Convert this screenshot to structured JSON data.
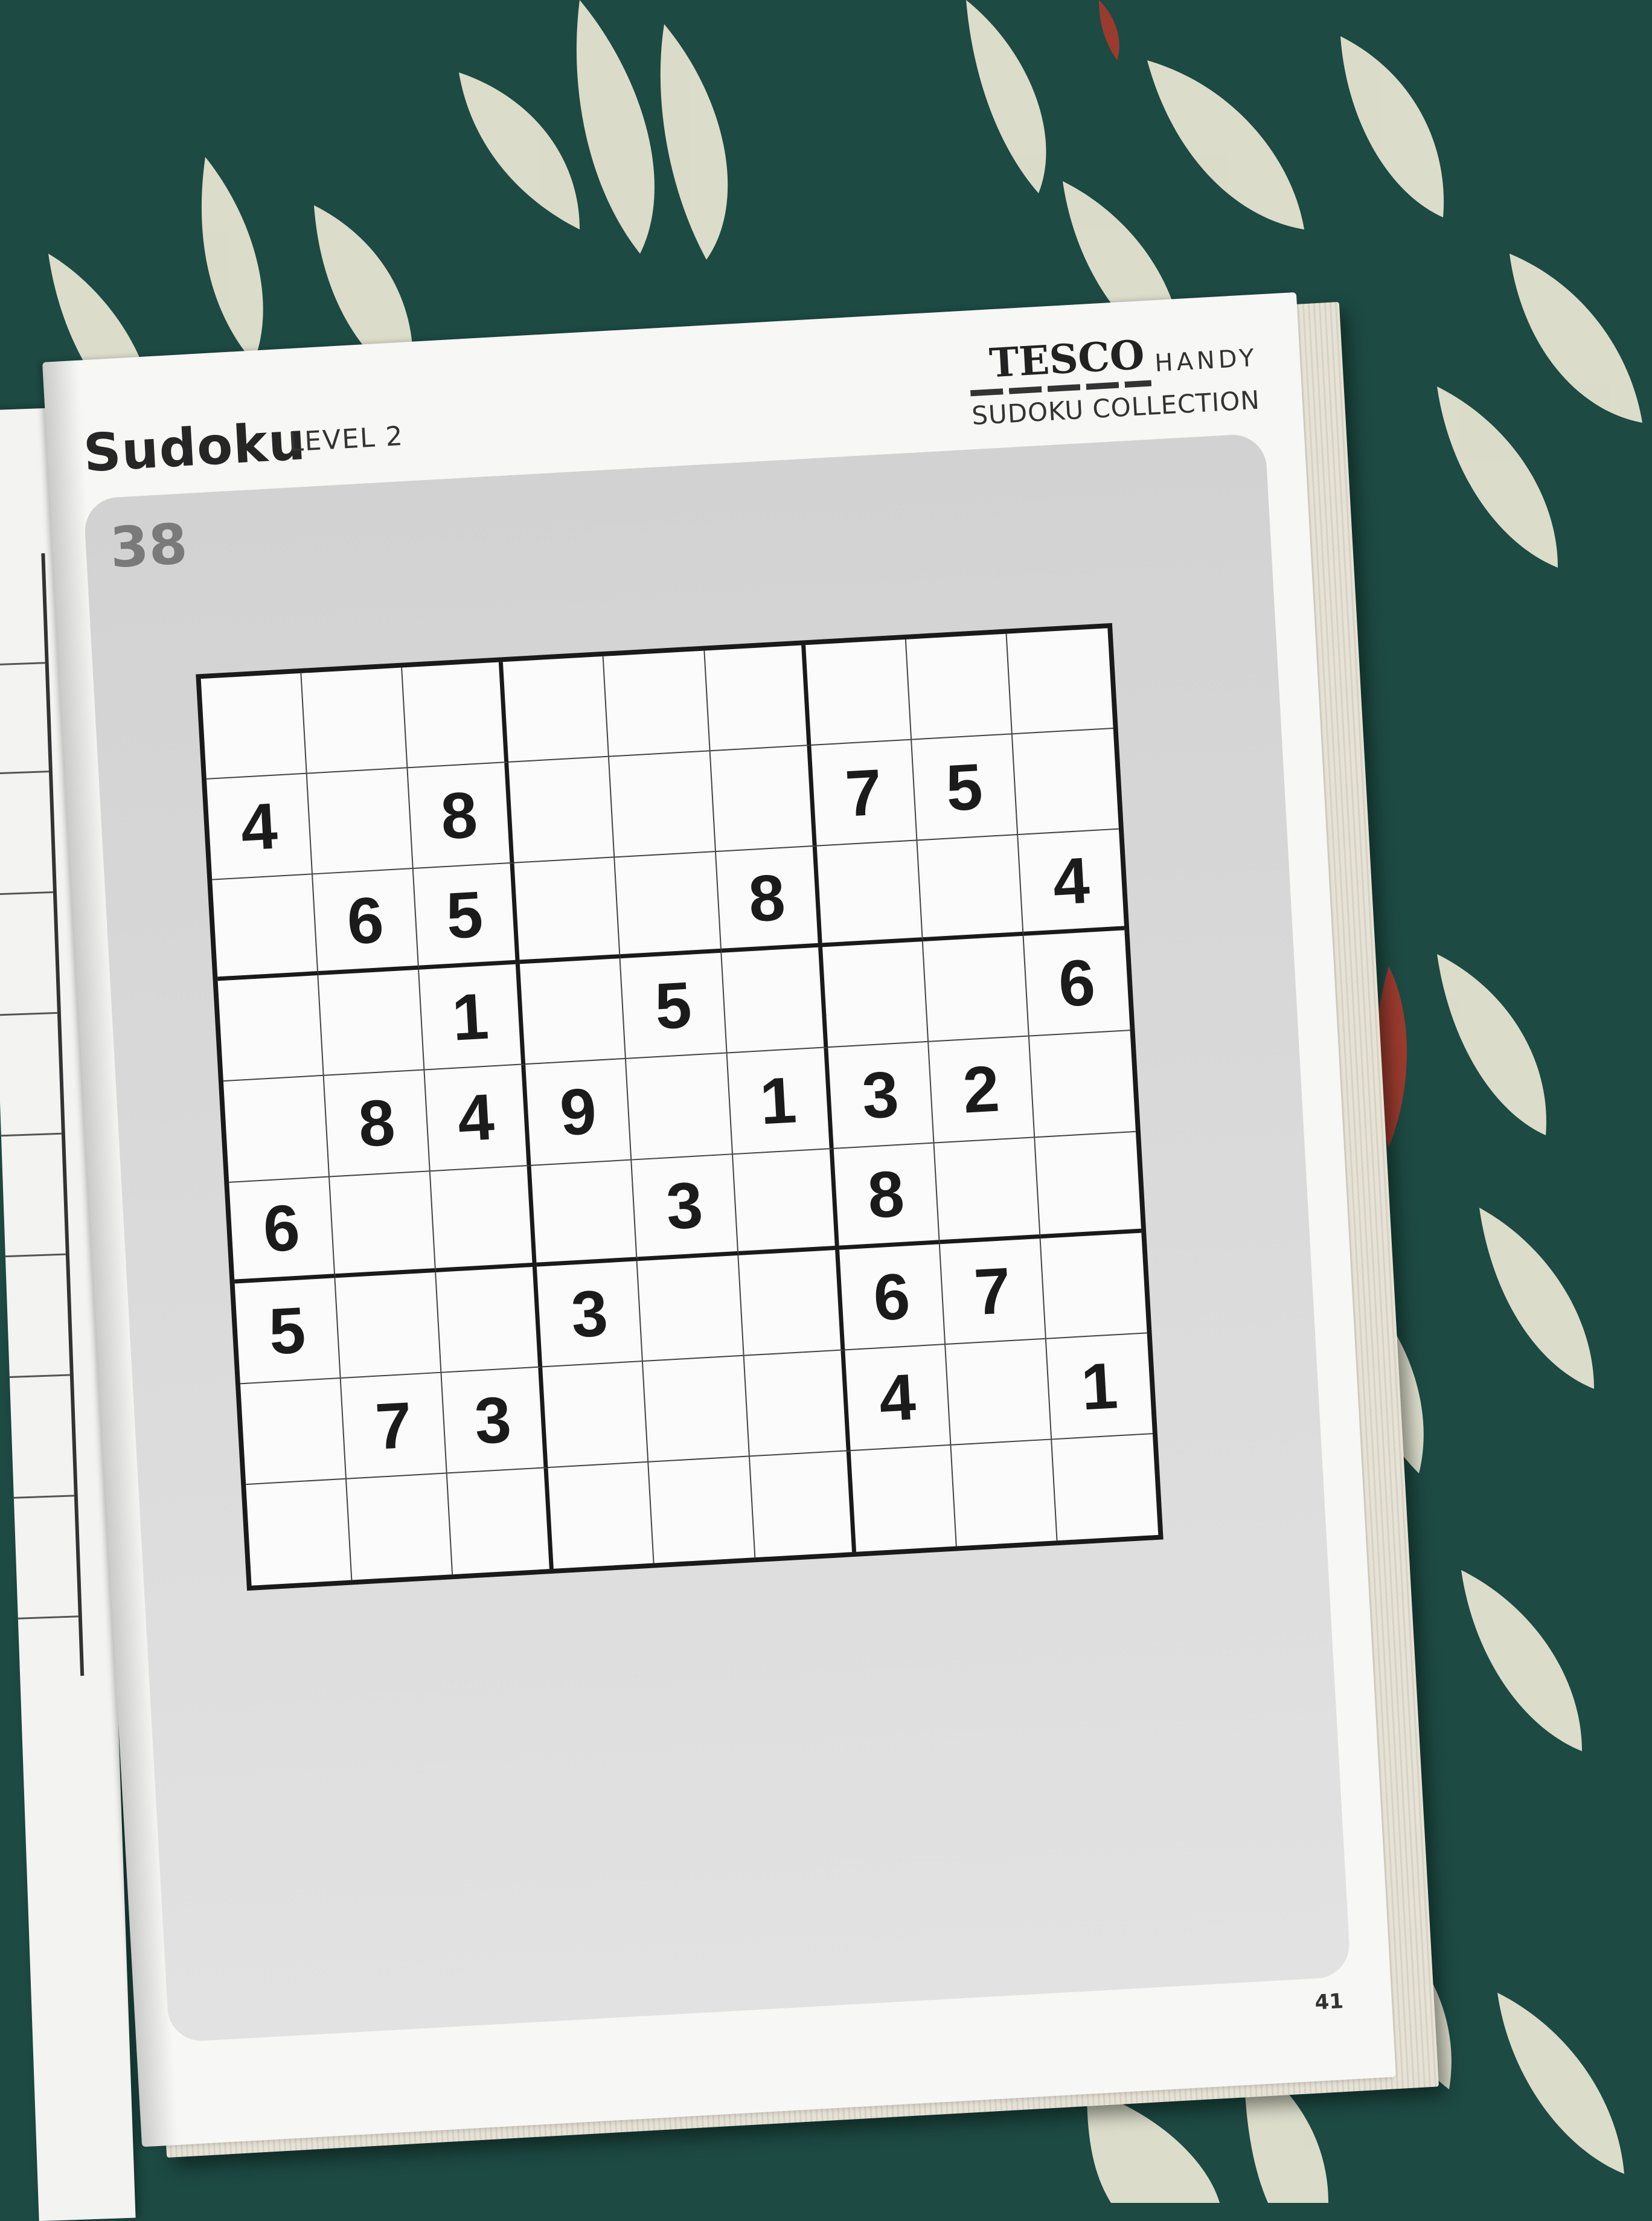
{
  "book": {
    "title": "Sudoku",
    "level": "LEVEL 2",
    "brand": "TESCO",
    "brand_suffix": "HANDY",
    "collection": "SUDOKU COLLECTION",
    "puzzle_number": "38",
    "page_number": "41"
  },
  "sudoku": {
    "grid": [
      [
        "",
        "",
        "",
        "",
        "",
        "",
        "",
        "",
        ""
      ],
      [
        "4",
        "",
        "8",
        "",
        "",
        "",
        "7",
        "5",
        ""
      ],
      [
        "",
        "6",
        "5",
        "",
        "",
        "8",
        "",
        "",
        "4"
      ],
      [
        "",
        "",
        "1",
        "",
        "5",
        "",
        "",
        "",
        "6"
      ],
      [
        "",
        "8",
        "4",
        "9",
        "",
        "1",
        "3",
        "2",
        ""
      ],
      [
        "6",
        "",
        "",
        "",
        "3",
        "",
        "8",
        "",
        ""
      ],
      [
        "5",
        "",
        "",
        "3",
        "",
        "",
        "6",
        "7",
        ""
      ],
      [
        "",
        "7",
        "3",
        "",
        "",
        "",
        "4",
        "",
        "1"
      ],
      [
        "",
        "",
        "",
        "",
        "",
        "",
        "",
        "",
        ""
      ]
    ]
  },
  "colors": {
    "fabric": "#1d4a43",
    "fabric_motif": "#ece8d6",
    "fabric_accent": "#9a3b2e",
    "page": "#f7f7f5",
    "panel": "#d6d6d6",
    "ink": "#1b1b1b"
  },
  "background": {
    "description_icon": "floral-fabric-icon"
  }
}
